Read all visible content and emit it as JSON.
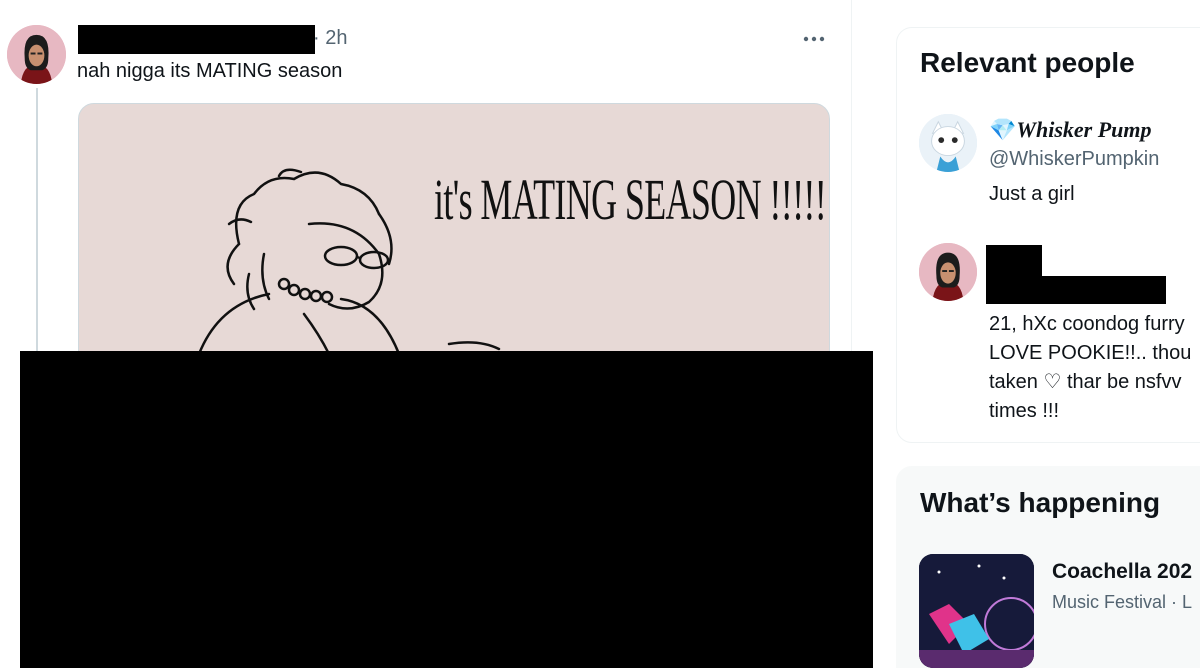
{
  "tweet": {
    "time": "· 2h",
    "text": "nah nigga its MATING season",
    "media_caption": "it's MATING SEASON !!!!!"
  },
  "sidebar": {
    "relevant_people": {
      "title": "Relevant people",
      "people": [
        {
          "name": "Whisker Pump",
          "handle": "@WhiskerPumpkin",
          "bio": [
            "Just a girl"
          ]
        },
        {
          "name": "",
          "handle": "",
          "bio": [
            "21, hXc coondog furry",
            "LOVE POOKIE!!.. thou",
            "taken ♡ thar be nsfvv",
            "times !!!"
          ]
        }
      ]
    },
    "whats_happening": {
      "title": "What’s happening",
      "trends": [
        {
          "title": "Coachella 202",
          "meta": "Music Festival · L"
        }
      ]
    }
  },
  "icons": {
    "more": "more-horizontal-icon",
    "gem": "gem-icon"
  }
}
